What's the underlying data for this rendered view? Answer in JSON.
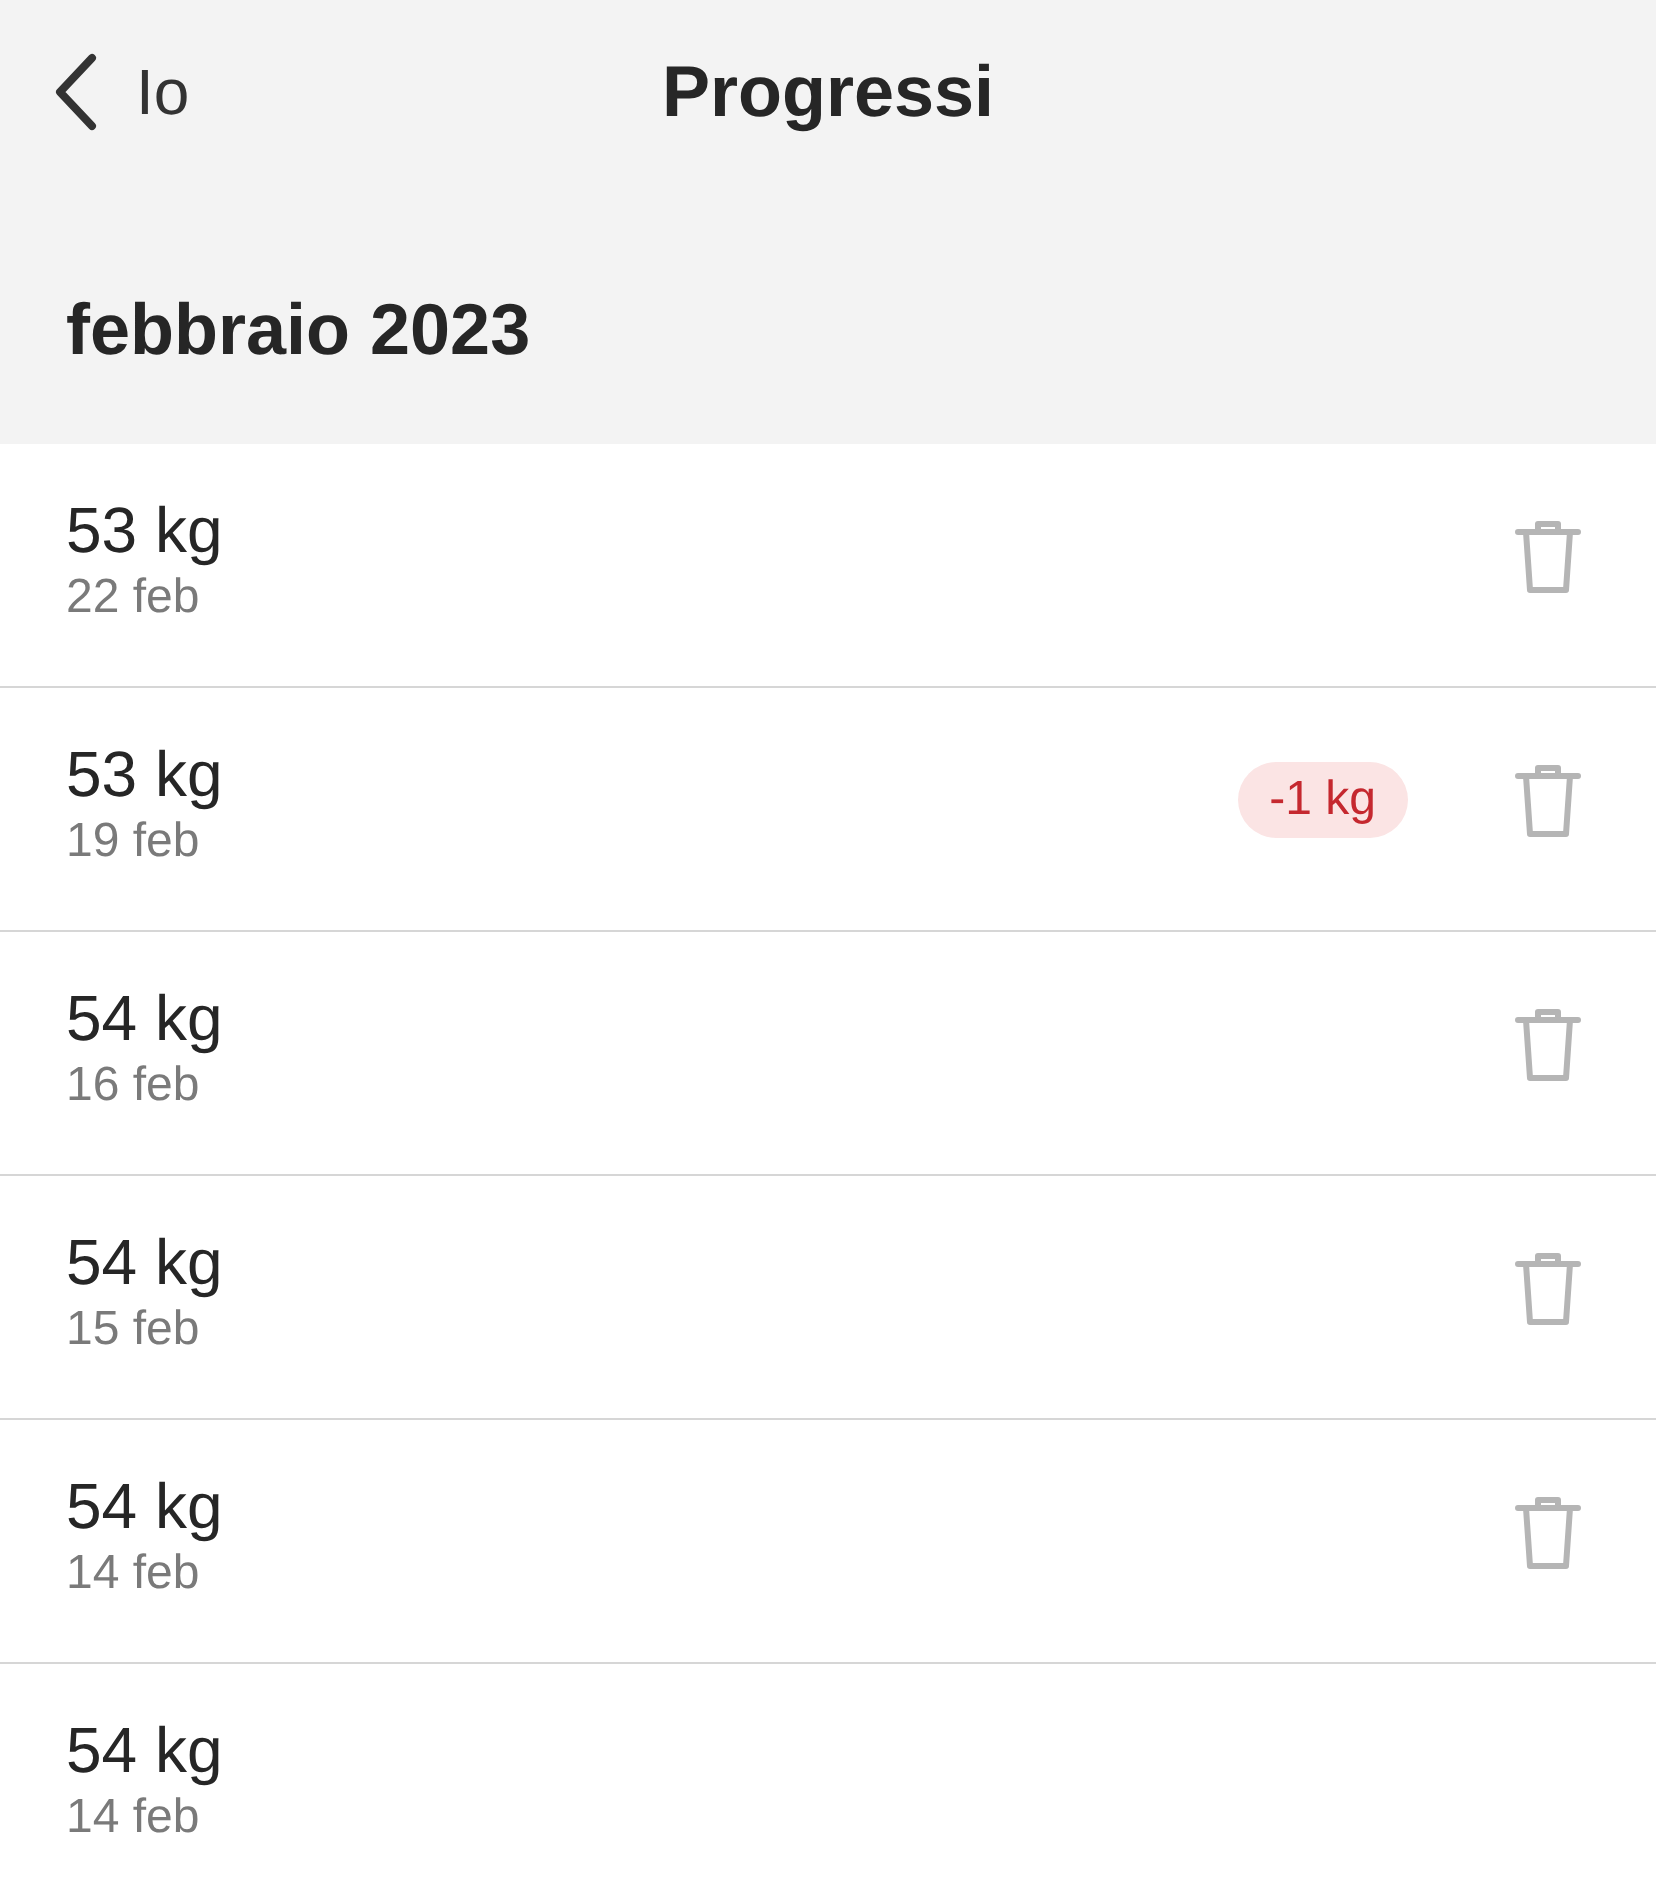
{
  "nav": {
    "back_label": "Io",
    "title": "Progressi"
  },
  "section": {
    "title": "febbraio 2023"
  },
  "entries": [
    {
      "weight": "53 kg",
      "date": "22 feb",
      "deletable": true
    },
    {
      "weight": "53 kg",
      "date": "19 feb",
      "change": "-1 kg",
      "deletable": true
    },
    {
      "weight": "54 kg",
      "date": "16 feb",
      "deletable": true
    },
    {
      "weight": "54 kg",
      "date": "15 feb",
      "deletable": true
    },
    {
      "weight": "54 kg",
      "date": "14 feb",
      "deletable": true
    },
    {
      "weight": "54 kg",
      "date": "14 feb",
      "deletable": false
    }
  ]
}
